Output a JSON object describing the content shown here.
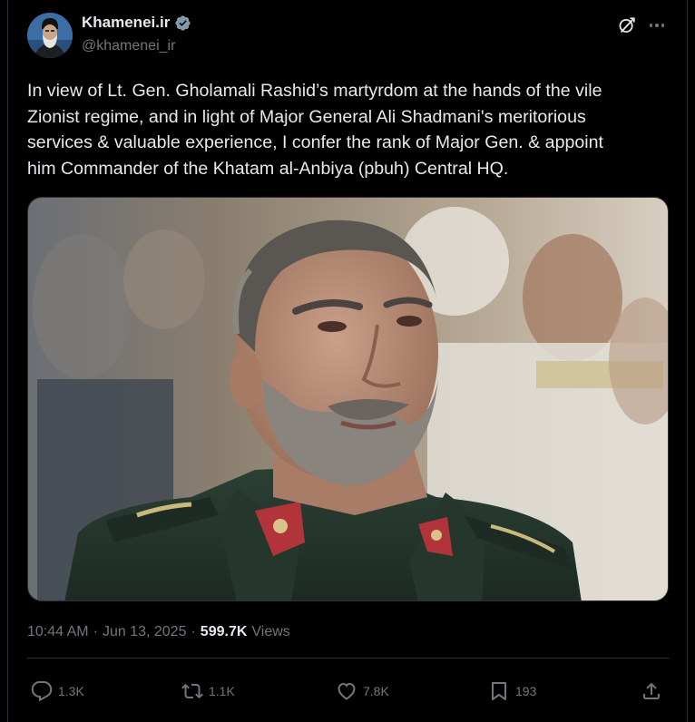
{
  "author": {
    "display_name": "Khamenei.ir",
    "handle": "@khamenei_ir",
    "verified": true
  },
  "tweet": {
    "text": "In view of Lt. Gen. Gholamali Rashid’s martyrdom at the hands of the vile\nZionist regime, and in light of Major General Ali Shadmani's meritorious\nservices & valuable experience, I confer the rank of Major Gen. & appoint\nhim Commander of the Khatam al-Anbiya (pbuh) Central HQ."
  },
  "meta": {
    "time": "10:44 AM",
    "separator": "·",
    "date": "Jun 13, 2025",
    "views_count": "599.7K",
    "views_label": "Views"
  },
  "actions": {
    "replies": "1.3K",
    "reposts": "1.1K",
    "likes": "7.8K",
    "bookmarks": "193"
  },
  "icons": {
    "verified": "verified-badge-icon",
    "grok": "grok-icon",
    "more": "more-icon",
    "reply": "reply-icon",
    "repost": "repost-icon",
    "like": "heart-icon",
    "bookmark": "bookmark-icon",
    "share": "share-icon"
  },
  "colors": {
    "background": "#000000",
    "text_primary": "#e7e9ea",
    "text_secondary": "#71767b",
    "border": "#2f3336",
    "verified_badge": "#829aab"
  }
}
